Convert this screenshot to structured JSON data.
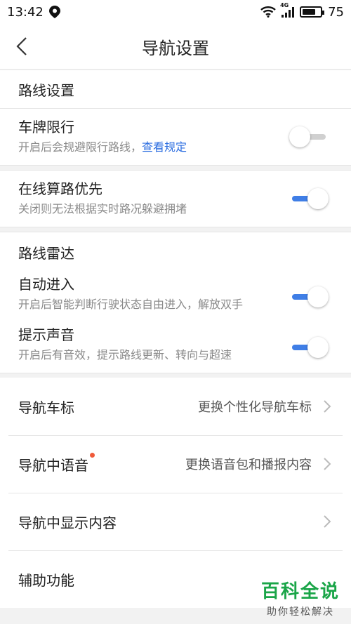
{
  "status_bar": {
    "time": "13:42",
    "network": "4G",
    "battery": "75",
    "battery_level": 0.75
  },
  "nav": {
    "title": "导航设置"
  },
  "route_settings": {
    "header": "路线设置",
    "plate_limit": {
      "title": "车牌限行",
      "desc": "开启后会规避限行路线，",
      "link": "查看规定",
      "enabled": false
    }
  },
  "online_priority": {
    "title": "在线算路优先",
    "desc": "关闭则无法根据实时路况躲避拥堵",
    "enabled": true
  },
  "radar": {
    "header": "路线雷达",
    "auto_enter": {
      "title": "自动进入",
      "desc": "开启后智能判断行驶状态自由进入，解放双手",
      "enabled": true
    },
    "sound": {
      "title": "提示声音",
      "desc": "开启后有音效，提示路线更新、转向与超速",
      "enabled": true
    }
  },
  "list": [
    {
      "label": "导航车标",
      "value": "更换个性化导航车标"
    },
    {
      "label": "导航中语音",
      "value": "更换语音包和播报内容",
      "badge": true
    },
    {
      "label": "导航中显示内容",
      "value": ""
    },
    {
      "label": "辅助功能",
      "value": ""
    }
  ],
  "watermark": {
    "main": "百科全说",
    "sub": "助你轻松解决"
  },
  "colors": {
    "accent": "#3f7ee6",
    "link": "#2b6de0",
    "badge": "#f05a3a",
    "watermark": "#1aa548"
  }
}
